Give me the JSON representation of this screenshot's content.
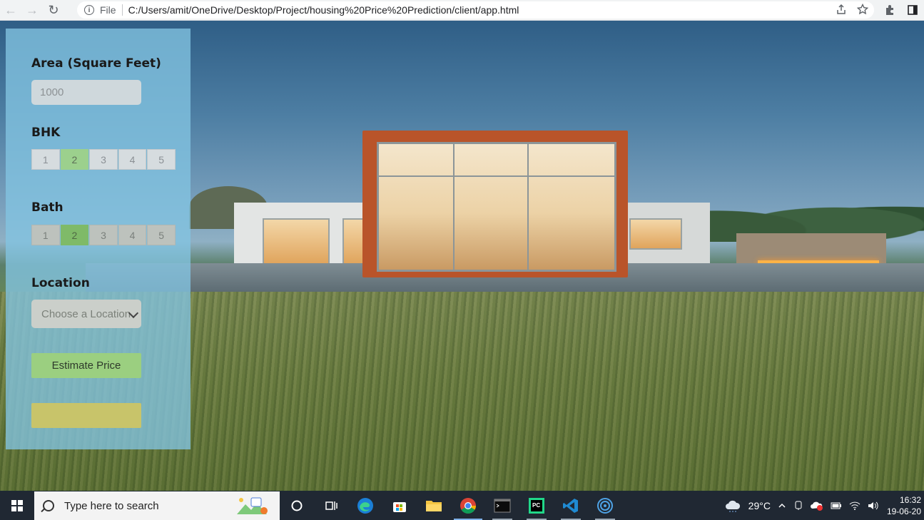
{
  "browser": {
    "nav": {
      "back": "←",
      "forward": "→",
      "reload": "↻"
    },
    "info_icon": "i",
    "scheme_label": "File",
    "url": "C:/Users/amit/OneDrive/Desktop/Project/housing%20Price%20Prediction/client/app.html",
    "icons": [
      "share-icon",
      "star-icon",
      "extensions-icon",
      "sidepanel-icon"
    ]
  },
  "form": {
    "area_label": "Area (Square Feet)",
    "area_value": "1000",
    "bhk_label": "BHK",
    "bhk_options": [
      "1",
      "2",
      "3",
      "4",
      "5"
    ],
    "bhk_selected": "2",
    "bath_label": "Bath",
    "bath_options": [
      "1",
      "2",
      "3",
      "4",
      "5"
    ],
    "bath_selected": "2",
    "location_label": "Location",
    "location_selected": "Choose a Location",
    "estimate_button": "Estimate Price",
    "result_text": ""
  },
  "taskbar": {
    "search_placeholder": "Type here to search",
    "apps": [
      "cortana-icon",
      "task-view-icon",
      "edge-icon",
      "store-icon",
      "file-explorer-icon",
      "chrome-icon",
      "terminal-icon",
      "pycharm-icon",
      "vscode-icon",
      "app-icon"
    ],
    "weather": "29°C",
    "time": "16:32",
    "date": "19-06-20"
  },
  "colors": {
    "panel": "#83c4e2",
    "selected_bhk": "#9cd08d",
    "selected_bath": "#7fba68",
    "button": "#9bcf80",
    "result": "#c8c46a"
  }
}
